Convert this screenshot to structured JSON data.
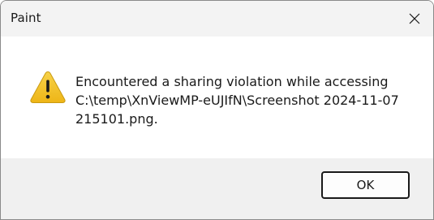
{
  "window": {
    "title": "Paint",
    "close_icon": "close-icon"
  },
  "message": {
    "icon": "warning-icon",
    "lines": [
      "Encountered a sharing violation while accessing",
      "C:\\temp\\XnViewMP-eUJIfN\\Screenshot 2024-11-07",
      "215101.png."
    ]
  },
  "buttons": {
    "ok_label": "OK"
  },
  "colors": {
    "warning_fill": "#f2c12e",
    "warning_stroke": "#c99a12",
    "footer_bg": "#f0f0f0",
    "titlebar_bg": "#f3f3f3"
  }
}
